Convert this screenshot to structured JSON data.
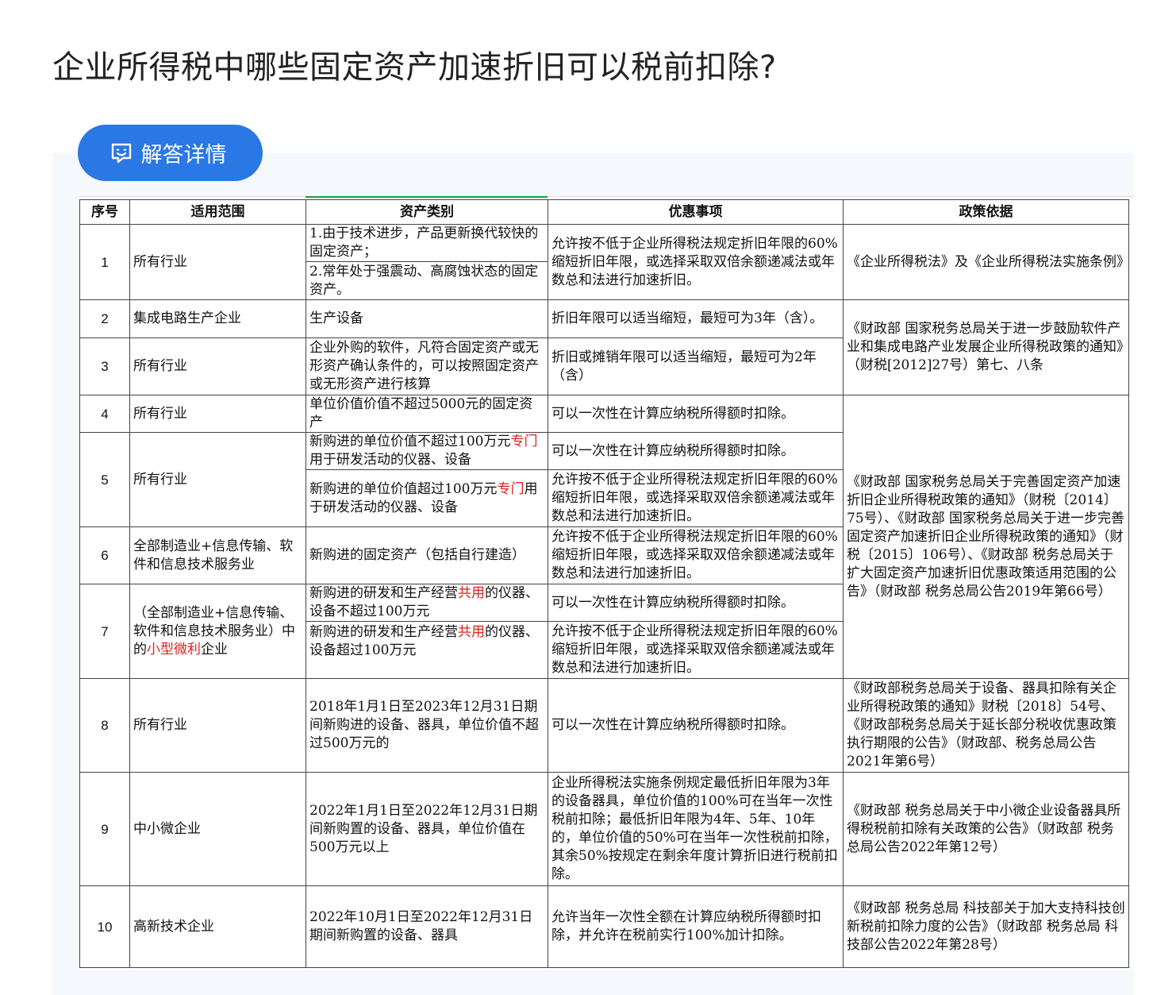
{
  "page": {
    "title": "企业所得税中哪些固定资产加速折旧可以税前扣除?"
  },
  "answer_button": {
    "label": "解答详情",
    "icon": "answer-detail-icon",
    "color": "#2a77e6"
  },
  "table": {
    "headers": [
      "序号",
      "适用范围",
      "资产类别",
      "优惠事项",
      "政策依据"
    ],
    "highlight_color": "#e02020",
    "rows": [
      {
        "num": "1",
        "scope": "所有行业",
        "assets": [
          "1.由于技术进步，产品更新换代较快的固定资产；",
          "2.常年处于强震动、高腐蚀状态的固定资产。"
        ],
        "benefit": "允许按不低于企业所得税法规定折旧年限的60%缩短折旧年限，或选择采取双倍余额递减法或年数总和法进行加速折旧。",
        "policy": "《企业所得税法》及《企业所得税法实施条例》"
      },
      {
        "num": "2",
        "scope": "集成电路生产企业",
        "asset": "生产设备",
        "benefit": "折旧年限可以适当缩短，最短可为3年（含）。"
      },
      {
        "num": "3",
        "scope": "所有行业",
        "asset": "企业外购的软件，凡符合固定资产或无形资产确认条件的，可以按照固定资产或无形资产进行核算",
        "benefit": "折旧或摊销年限可以适当缩短，最短可为2年（含）"
      },
      {
        "num": "4",
        "scope": "所有行业",
        "asset": "单位价值价值不超过5000元的固定资产",
        "benefit": "可以一次性在计算应纳税所得额时扣除。"
      },
      {
        "num": "5",
        "scope": "所有行业",
        "asset_a_pre": "新购进的单位价值不超过100万元",
        "asset_a_red": "专门",
        "asset_a_post": "用于研发活动的仪器、设备",
        "benefit_a": "可以一次性在计算应纳税所得额时扣除。",
        "asset_b_pre": "新购进的单位价值超过100万元",
        "asset_b_red": "专门",
        "asset_b_post": "用于研发活动的仪器、设备",
        "benefit_b": "允许按不低于企业所得税法规定折旧年限的60%缩短折旧年限，或选择采取双倍余额递减法或年数总和法进行加速折旧。"
      },
      {
        "num": "6",
        "scope": "全部制造业+信息传输、软件和信息技术服务业",
        "asset": "新购进的固定资产（包括自行建造）",
        "benefit": "允许按不低于企业所得税法规定折旧年限的60%缩短折旧年限，或选择采取双倍余额递减法或年数总和法进行加速折旧。"
      },
      {
        "num": "7",
        "scope_pre": "（全部制造业+信息传输、软件和信息技术服务业）中的",
        "scope_red": "小型微利",
        "scope_post": "企业",
        "asset_a_pre": "新购进的研发和生产经营",
        "asset_a_red": "共用",
        "asset_a_post": "的仪器、设备不超过100万元",
        "benefit_a": "可以一次性在计算应纳税所得额时扣除。",
        "asset_b_pre": "新购进的研发和生产经营",
        "asset_b_red": "共用",
        "asset_b_post": "的仪器、设备超过100万元",
        "benefit_b": "允许按不低于企业所得税法规定折旧年限的60%缩短折旧年限，或选择采取双倍余额递减法或年数总和法进行加速折旧。"
      },
      {
        "num": "8",
        "scope": "所有行业",
        "asset": "2018年1月1日至2023年12月31日期间新购进的设备、器具，单位价值不超过500万元的",
        "benefit": "可以一次性在计算应纳税所得额时扣除。",
        "policy": "《财政部税务总局关于设备、器具扣除有关企业所得税政策的通知》财税〔2018〕54号、《财政部税务总局关于延长部分税收优惠政策执行期限的公告》（财政部、税务总局公告2021年第6号）"
      },
      {
        "num": "9",
        "scope": "中小微企业",
        "asset": "2022年1月1日至2022年12月31日期间新购置的设备、器具，单位价值在500万元以上",
        "benefit": "企业所得税法实施条例规定最低折旧年限为3年的设备器具，单位价值的100%可在当年一次性税前扣除；最低折旧年限为4年、5年、10年的，单位价值的50%可在当年一次性税前扣除，其余50%按规定在剩余年度计算折旧进行税前扣除。",
        "policy": "《财政部 税务总局关于中小微企业设备器具所得税税前扣除有关政策的公告》（财政部 税务总局公告2022年第12号）"
      },
      {
        "num": "10",
        "scope": "高新技术企业",
        "asset": "2022年10月1日至2022年12月31日期间新购置的设备、器具",
        "benefit": "允许当年一次性全额在计算应纳税所得额时扣除，并允许在税前实行100%加计扣除。",
        "policy": "《财政部 税务总局 科技部关于加大支持科技创新税前扣除力度的公告》（财政部 税务总局 科技部公告2022年第28号）"
      }
    ],
    "policy_2_3": "《财政部 国家税务总局关于进一步鼓励软件产业和集成电路产业发展企业所得税政策的通知》（财税[2012]27号）第七、八条",
    "policy_4_7": "《财政部 国家税务总局关于完善固定资产加速折旧企业所得税政策的通知》（财税〔2014〕75号）、《财政部 国家税务总局关于进一步完善固定资产加速折旧企业所得税政策的通知》（财税〔2015〕106号）、《财政部 税务总局关于扩大固定资产加速折旧优惠政策适用范围的公告》（财政部 税务总局公告2019年第66号）"
  }
}
